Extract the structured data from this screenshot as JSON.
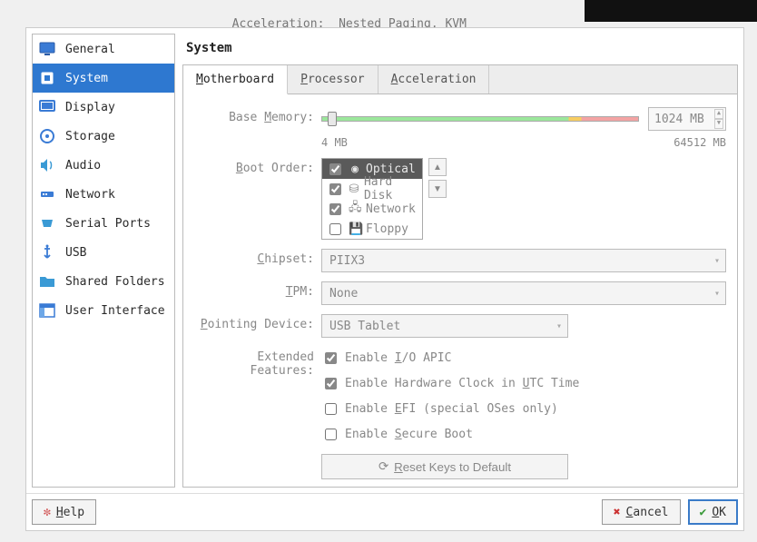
{
  "background": {
    "accel_label": "Acceleration:",
    "accel_value": "Nested Paging, KVM"
  },
  "sidebar": {
    "items": [
      {
        "label": "General"
      },
      {
        "label": "System"
      },
      {
        "label": "Display"
      },
      {
        "label": "Storage"
      },
      {
        "label": "Audio"
      },
      {
        "label": "Network"
      },
      {
        "label": "Serial Ports"
      },
      {
        "label": "USB"
      },
      {
        "label": "Shared Folders"
      },
      {
        "label": "User Interface"
      }
    ],
    "selected_index": 1
  },
  "content": {
    "title": "System",
    "tabs": [
      {
        "label": "Motherboard",
        "mn": "M"
      },
      {
        "label": "Processor",
        "mn": "P"
      },
      {
        "label": "Acceleration",
        "mn": "A"
      }
    ],
    "active_tab": 0,
    "motherboard": {
      "base_memory_label": "Base Memory:",
      "base_memory_value": "1024 MB",
      "base_memory_min": "4 MB",
      "base_memory_max": "64512 MB",
      "boot_order_label": "Boot Order:",
      "boot_items": [
        {
          "label": "Optical",
          "checked": true,
          "icon": "◉",
          "selected": true
        },
        {
          "label": "Hard Disk",
          "checked": true,
          "icon": "⛀",
          "selected": false
        },
        {
          "label": "Network",
          "checked": true,
          "icon": "🖧",
          "selected": false
        },
        {
          "label": "Floppy",
          "checked": false,
          "icon": "💾",
          "selected": false
        }
      ],
      "chipset_label": "Chipset:",
      "chipset_value": "PIIX3",
      "tpm_label": "TPM:",
      "tpm_value": "None",
      "pointing_label": "Pointing Device:",
      "pointing_value": "USB Tablet",
      "ext_label": "Extended Features:",
      "feat_ioapic": "Enable I/O APIC",
      "feat_ioapic_checked": true,
      "feat_utc": "Enable Hardware Clock in UTC Time",
      "feat_utc_checked": true,
      "feat_efi": "Enable EFI (special OSes only)",
      "feat_efi_checked": false,
      "feat_secureboot": "Enable Secure Boot",
      "feat_secureboot_checked": false,
      "reset_label": "Reset Keys to Default"
    }
  },
  "footer": {
    "help": "Help",
    "cancel": "Cancel",
    "ok": "OK"
  }
}
